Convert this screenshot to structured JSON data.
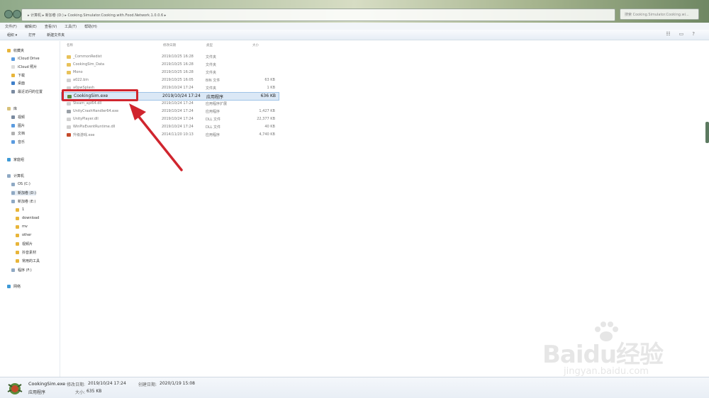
{
  "address": {
    "path": "▸ 计算机 ▸ 新加卷 (D:) ▸ Cooking.Simulator.Cooking.with.Food.Network.1.0.0.6 ▸"
  },
  "search": {
    "placeholder": "搜索 Cooking.Simulator.Cooking.wi..."
  },
  "menu": [
    "文件(F)",
    "编辑(E)",
    "查看(V)",
    "工具(T)",
    "帮助(H)"
  ],
  "toolbar": [
    "组织 ▾",
    "打开",
    "新建文件夹"
  ],
  "sidebar": {
    "items": [
      {
        "label": "收藏夹",
        "icon": "star-icon",
        "color": "#e8b53a"
      },
      {
        "label": "iCloud Drive",
        "icon": "folder-icon",
        "color": "#5a9be0"
      },
      {
        "label": "iCloud 照片",
        "icon": "folder-icon",
        "color": "#dcdcdc"
      },
      {
        "label": "下载",
        "icon": "folder-icon",
        "color": "#e8b53a"
      },
      {
        "label": "桌面",
        "icon": "folder-icon",
        "color": "#3f7fc9"
      },
      {
        "label": "最近访问的位置",
        "icon": "folder-icon",
        "color": "#7a8aa0"
      },
      {
        "label": "库",
        "icon": "library-icon",
        "color": "#d8c27a"
      },
      {
        "label": "视频",
        "icon": "folder-icon",
        "color": "#7a8aa0"
      },
      {
        "label": "图片",
        "icon": "folder-icon",
        "color": "#5a9be0"
      },
      {
        "label": "文档",
        "icon": "folder-icon",
        "color": "#b0b0b0"
      },
      {
        "label": "音乐",
        "icon": "folder-icon",
        "color": "#5a9be0"
      },
      {
        "label": "家庭组",
        "icon": "homegroup-icon",
        "color": "#3f9ad6"
      },
      {
        "label": "计算机",
        "icon": "computer-icon",
        "color": "#8fa9c4"
      },
      {
        "label": "OS (C:)",
        "icon": "drive-icon",
        "color": "#8fa9c4"
      },
      {
        "label": "新加卷 (D:)",
        "icon": "drive-icon",
        "color": "#8fa9c4"
      },
      {
        "label": "新加卷 (E:)",
        "icon": "drive-icon",
        "color": "#8fa9c4"
      },
      {
        "label": "1",
        "icon": "folder-icon",
        "color": "#e8b53a"
      },
      {
        "label": "download",
        "icon": "folder-icon",
        "color": "#e8b53a"
      },
      {
        "label": "mv",
        "icon": "folder-icon",
        "color": "#e8b53a"
      },
      {
        "label": "other",
        "icon": "folder-icon",
        "color": "#e8b53a"
      },
      {
        "label": "视频片",
        "icon": "folder-icon",
        "color": "#e8b53a"
      },
      {
        "label": "抖音素材",
        "icon": "folder-icon",
        "color": "#e8b53a"
      },
      {
        "label": "常用的工具",
        "icon": "folder-icon",
        "color": "#e8b53a"
      },
      {
        "label": "程序 (F:)",
        "icon": "drive-icon",
        "color": "#8fa9c4"
      },
      {
        "label": "网络",
        "icon": "network-icon",
        "color": "#3f9ad6"
      }
    ]
  },
  "columns": {
    "name": "名称",
    "date": "修改日期",
    "type": "类型",
    "size": "大小"
  },
  "files": [
    {
      "name": "_CommonRedist",
      "date": "2019/10/25 16:28",
      "type": "文件夹",
      "size": "",
      "icon": "folder-icon",
      "color": "#e8c25a"
    },
    {
      "name": "CookingSim_Data",
      "date": "2019/10/25 16:28",
      "type": "文件夹",
      "size": "",
      "icon": "folder-icon",
      "color": "#e8c25a"
    },
    {
      "name": "Mono",
      "date": "2019/10/25 16:28",
      "type": "文件夹",
      "size": "",
      "icon": "folder-icon",
      "color": "#e8c25a"
    },
    {
      "name": "a022.bin",
      "date": "2019/10/25 16:05",
      "type": "BIN 文件",
      "size": "63 KB",
      "icon": "file-icon",
      "color": "#d0d0d0"
    },
    {
      "name": "a0pwSplash",
      "date": "2019/10/24 17:24",
      "type": "文件夹",
      "size": "1 KB",
      "icon": "file-icon",
      "color": "#d0d0d0"
    },
    {
      "name": "CookingSim.exe",
      "date": "2019/10/24 17:24",
      "type": "应用程序",
      "size": "636 KB",
      "icon": "app-icon",
      "color": "#5a8a3a"
    },
    {
      "name": "Steam_api64.dll",
      "date": "2019/10/24 17:24",
      "type": "应用程序扩展",
      "size": "",
      "icon": "file-icon",
      "color": "#d0d0d0"
    },
    {
      "name": "UnityCrashHandler64.exe",
      "date": "2019/10/24 17:24",
      "type": "应用程序",
      "size": "1,427 KB",
      "icon": "app-icon",
      "color": "#9aa0a6"
    },
    {
      "name": "UnityPlayer.dll",
      "date": "2019/10/24 17:24",
      "type": "DLL 文件",
      "size": "22,377 KB",
      "icon": "file-icon",
      "color": "#d0d0d0"
    },
    {
      "name": "WinPixEventRuntime.dll",
      "date": "2019/10/24 17:24",
      "type": "DLL 文件",
      "size": "40 KB",
      "icon": "file-icon",
      "color": "#d0d0d0"
    },
    {
      "name": "升级游戏.exe",
      "date": "2014/11/20 10:13",
      "type": "应用程序",
      "size": "4,740 KB",
      "icon": "app-icon",
      "color": "#c44a2a"
    }
  ],
  "details": {
    "filename": "CookingSim.exe",
    "modified_label": "修改日期:",
    "modified": "2019/10/24 17:24",
    "created_label": "创建日期:",
    "created": "2020/1/19 15:08",
    "type": "应用程序",
    "size_label": "大小:",
    "size": "635 KB"
  },
  "watermark": {
    "logo": "Baidu经验",
    "sub": "jingyan.baidu.com"
  },
  "accent": {
    "highlight": "#d0252e",
    "arrow": "#d0252e",
    "selection": "#dbe8f6"
  }
}
